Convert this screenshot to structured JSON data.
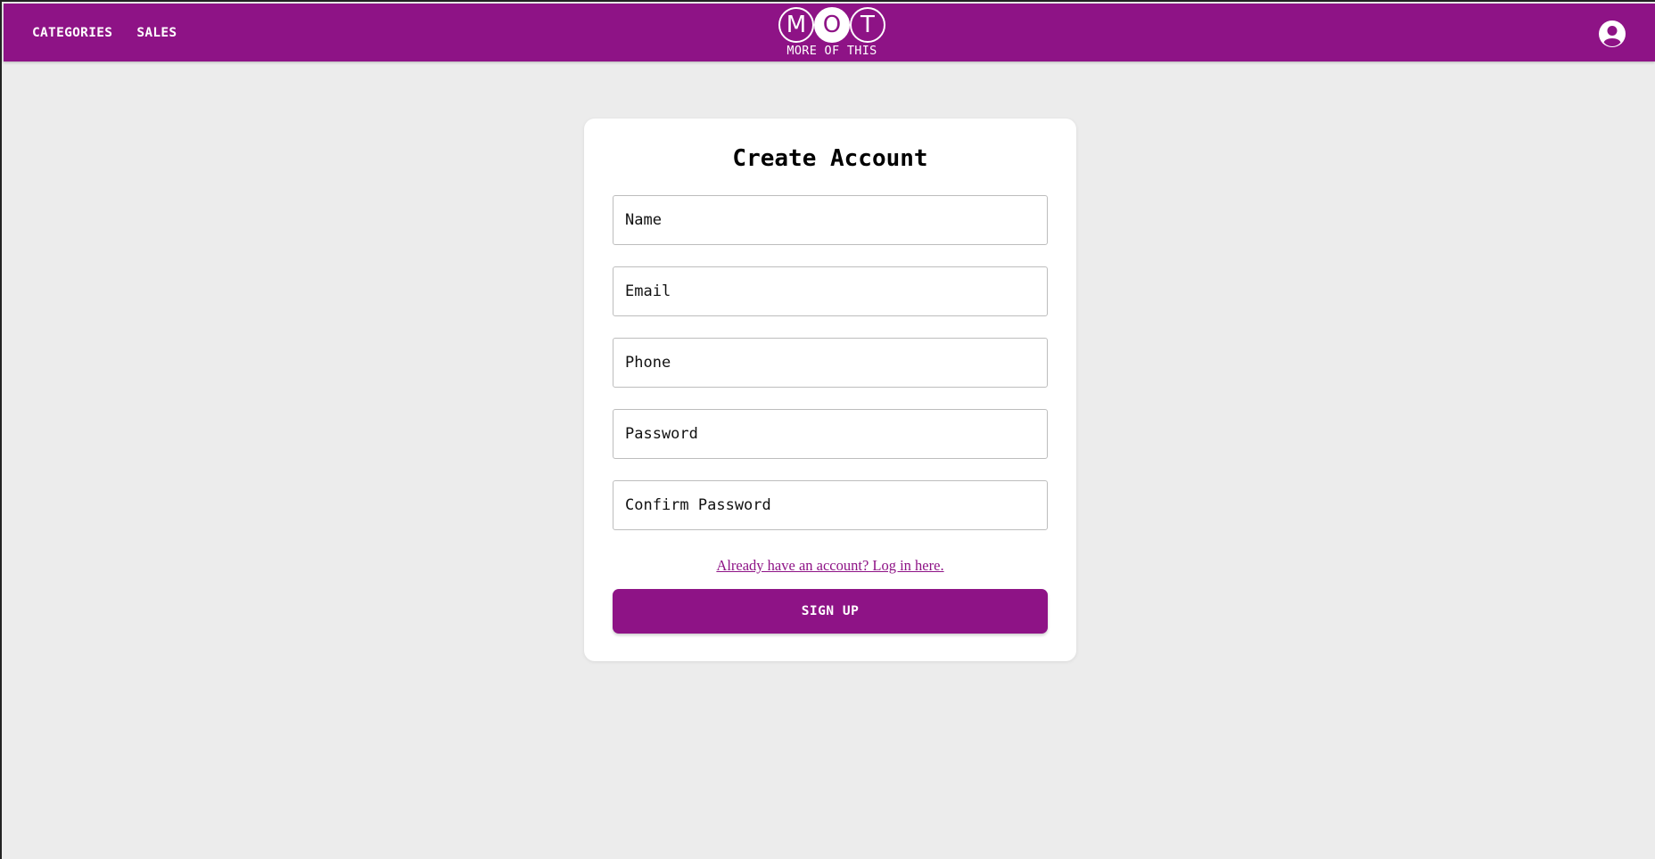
{
  "nav": {
    "links": [
      "CATEGORIES",
      "SALES"
    ],
    "logo": {
      "letters": [
        "M",
        "O",
        "T"
      ],
      "subtitle": "MORE OF THIS"
    },
    "account_icon": "account-circle-icon"
  },
  "form": {
    "title": "Create Account",
    "fields": [
      {
        "placeholder": "Name",
        "value": ""
      },
      {
        "placeholder": "Email",
        "value": ""
      },
      {
        "placeholder": "Phone",
        "value": ""
      },
      {
        "placeholder": "Password",
        "value": ""
      },
      {
        "placeholder": "Confirm Password",
        "value": ""
      }
    ],
    "login_link": "Already have an account? Log in here.",
    "submit_label": "SIGN UP"
  },
  "colors": {
    "brand": "#8e1386",
    "background": "#ececec",
    "card": "#ffffff"
  }
}
